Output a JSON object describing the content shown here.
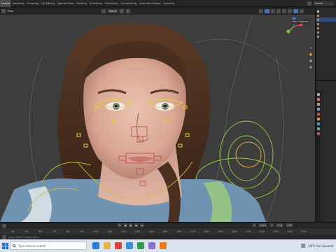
{
  "app": {
    "workspace_tabs": [
      "Layout",
      "Modeling",
      "Sculpting",
      "UV Editing",
      "Texture Paint",
      "Shading",
      "Animation",
      "Rendering",
      "Compositing",
      "Geometry Nodes",
      "Scripting"
    ],
    "active_tab": "Layout",
    "scene_name": "Scene"
  },
  "viewport_header": {
    "mode": "Pose",
    "transform_orientation": "Global",
    "pose_options_label": "Pose Options"
  },
  "timeline": {
    "ticks": [
      "40",
      "50",
      "60",
      "70",
      "80",
      "90",
      "100",
      "110",
      "120",
      "130",
      "140",
      "150",
      "160",
      "170",
      "180",
      "190",
      "200",
      "210",
      "220",
      "230",
      "240",
      "250"
    ],
    "current_frame": "1",
    "start_label": "Start",
    "start_value": "1",
    "end_label": "End",
    "end_value": "250",
    "status_text": "Drag Sheet Context Menu"
  },
  "taskbar": {
    "search_placeholder": "Type here to search",
    "weather": "14°C Cer couvert"
  },
  "colors": {
    "accent": "#4772b3",
    "bone_yellow": "#e3d23a",
    "bone_red": "#c84b4b",
    "rig_green": "#8fcf3a"
  }
}
